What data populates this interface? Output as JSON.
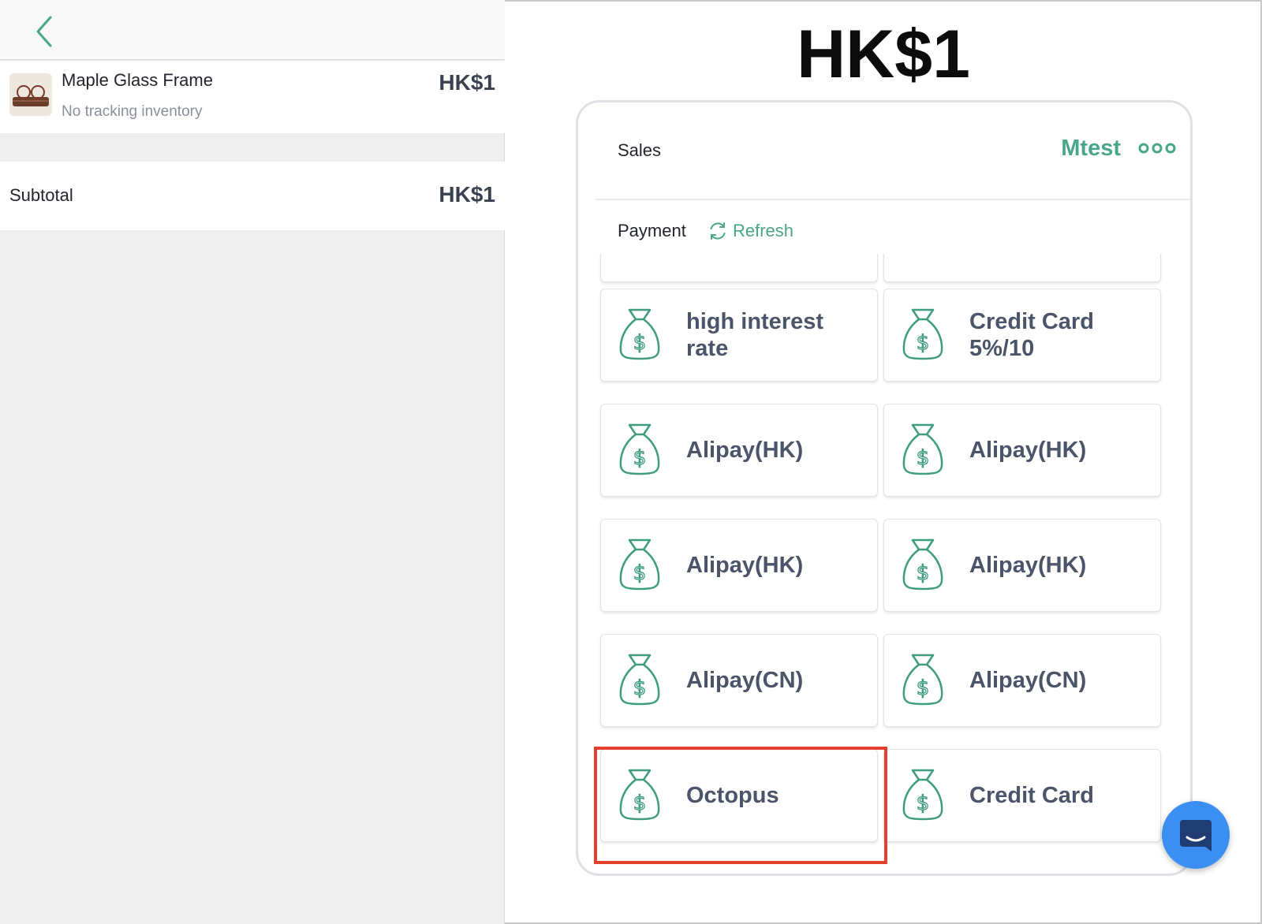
{
  "left_pane": {
    "cart_item": {
      "name": "Maple Glass Frame",
      "subtitle": "No tracking inventory",
      "price": "HK$1",
      "thumbnail_icon": "eyeglasses-thumbnail"
    },
    "subtotal": {
      "label": "Subtotal",
      "value": "HK$1"
    }
  },
  "total": "HK$1",
  "panel": {
    "sales_label": "Sales",
    "store_name": "Mtest",
    "payment_label": "Payment",
    "refresh_label": "Refresh"
  },
  "payment_methods": [
    {
      "label": "high interest rate"
    },
    {
      "label": "Credit Card 5%/10"
    },
    {
      "label": "Alipay(HK)"
    },
    {
      "label": "Alipay(HK)"
    },
    {
      "label": "Alipay(HK)"
    },
    {
      "label": "Alipay(HK)"
    },
    {
      "label": "Alipay(CN)"
    },
    {
      "label": "Alipay(CN)"
    },
    {
      "label": "Octopus"
    },
    {
      "label": "Credit Card"
    }
  ],
  "colors": {
    "accent": "#4aa68b",
    "highlight": "#e6402d",
    "chat": "#3b8ef2"
  }
}
